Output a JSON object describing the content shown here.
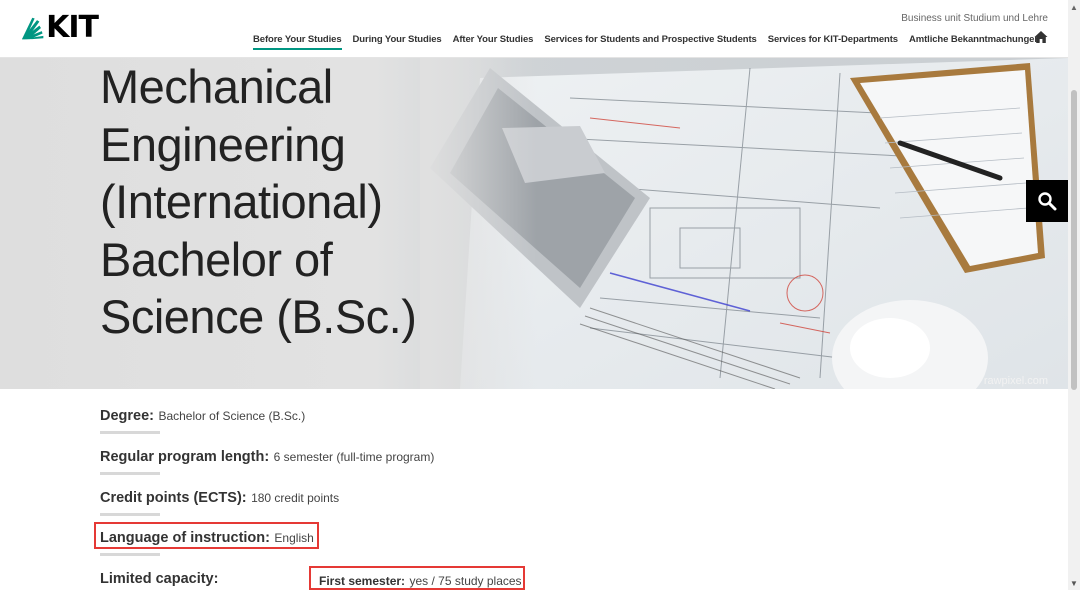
{
  "header": {
    "logo_text": "KIT",
    "business_unit": "Business unit Studium und Lehre",
    "nav": [
      {
        "label": "Before Your Studies",
        "active": true
      },
      {
        "label": "During Your Studies",
        "active": false
      },
      {
        "label": "After Your Studies",
        "active": false
      },
      {
        "label": "Services for Students and Prospective Students",
        "active": false
      },
      {
        "label": "Services for KIT-Departments",
        "active": false
      },
      {
        "label": "Amtliche Bekanntmachungen",
        "active": false
      }
    ],
    "home_icon": "home-icon"
  },
  "hero": {
    "title_lines": [
      "Mechanical",
      "Engineering",
      "(International)",
      "Bachelor of",
      "Science (B.Sc.)"
    ],
    "image_credit": "rawpixel.com",
    "search_icon": "search-icon"
  },
  "facts": [
    {
      "label": "Degree:",
      "value": "Bachelor of Science (B.Sc.)",
      "highlighted": false
    },
    {
      "label": "Regular program length:",
      "value": "6 semester (full-time program)",
      "highlighted": false
    },
    {
      "label": "Credit points (ECTS):",
      "value": "180 credit points",
      "highlighted": false
    },
    {
      "label": "Language of instruction:",
      "value": "English",
      "highlighted": true
    },
    {
      "label": "Limited capacity:",
      "value": "",
      "highlighted": false
    }
  ],
  "capacity": {
    "label": "First semester:",
    "value": "yes / 75 study places",
    "highlighted": true
  },
  "colors": {
    "accent": "#009682",
    "highlight": "#e53935"
  }
}
